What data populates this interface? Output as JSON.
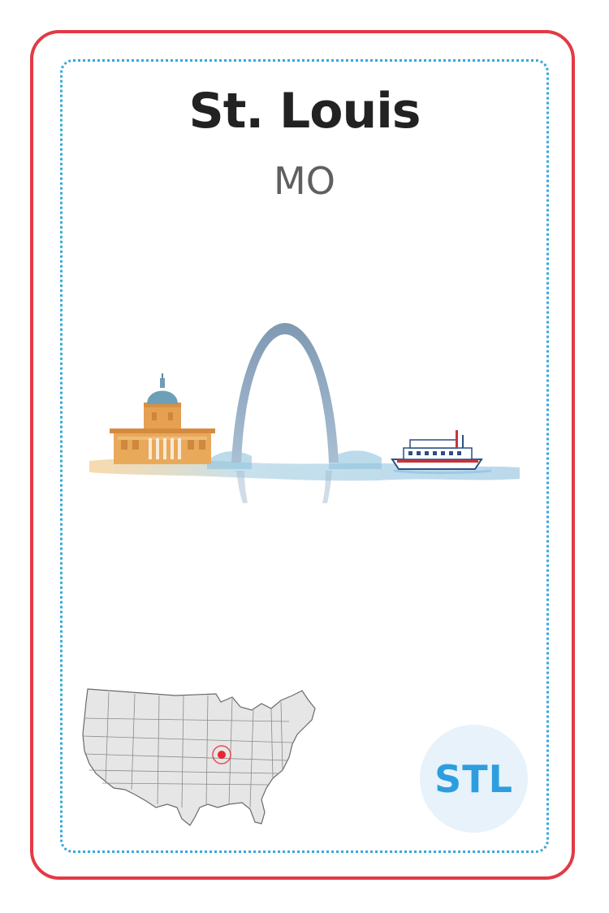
{
  "card": {
    "city": "St. Louis",
    "state": "MO",
    "code": "STL"
  },
  "colors": {
    "outer_border": "#e23a44",
    "inner_border": "#36a7de",
    "badge_text": "#2c9ee0",
    "badge_bg": "#e7f2fa",
    "marker": "#e8262d"
  },
  "icons": {
    "skyline": "st-louis-skyline-illustration",
    "map": "us-map-icon",
    "location": "location-marker-icon"
  }
}
